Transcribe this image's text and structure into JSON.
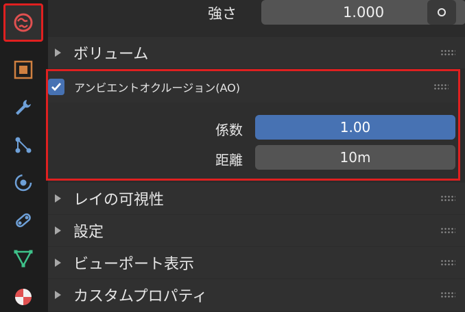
{
  "strength": {
    "label": "強さ",
    "value": "1.000"
  },
  "sections": {
    "volume": "ボリューム",
    "ao": "アンビエントオクルージョン(AO)",
    "ray_visibility": "レイの可視性",
    "settings": "設定",
    "viewport": "ビューポート表示",
    "custom_props": "カスタムプロパティ"
  },
  "ao": {
    "enabled": true,
    "factor_label": "係数",
    "factor_value": "1.00",
    "distance_label": "距離",
    "distance_value": "10m"
  },
  "tabs": [
    "world-icon",
    "object-icon",
    "modifier-icon",
    "particles-icon",
    "physics-icon",
    "constraints-icon",
    "object-data-icon",
    "material-icon"
  ],
  "colors": {
    "accent": "#4772b3",
    "highlight": "#e02020"
  }
}
